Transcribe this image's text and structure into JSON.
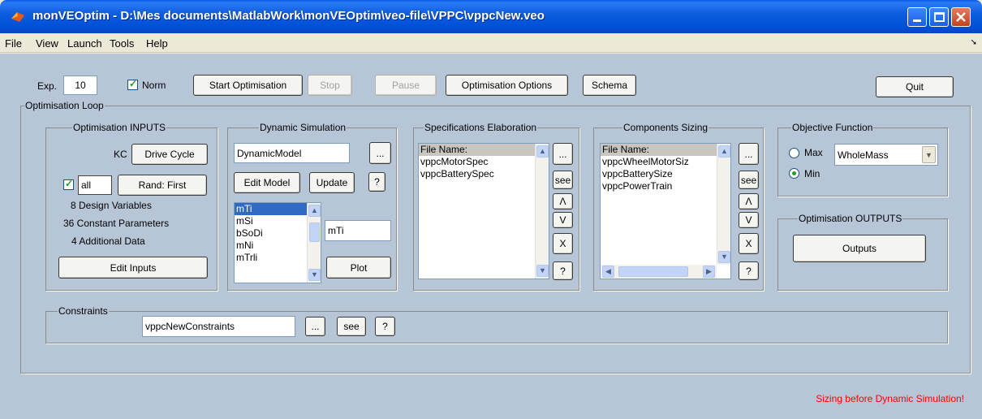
{
  "window": {
    "title": "monVEOptim - D:\\Mes documents\\MatlabWork\\monVEOptim\\veo-file\\VPPC\\vppcNew.veo"
  },
  "menu": [
    "File",
    "View",
    "Launch",
    "Tools",
    "Help"
  ],
  "menu_dock_glyph": "➘",
  "toolbar": {
    "exp_label": "Exp.",
    "exp_value": "10",
    "norm_label": "Norm",
    "start": "Start Optimisation",
    "stop": "Stop",
    "pause": "Pause",
    "options": "Optimisation Options",
    "schema": "Schema",
    "quit": "Quit"
  },
  "optim_loop": {
    "title": "Optimisation Loop"
  },
  "inputs": {
    "title": "Optimisation INPUTS",
    "kc_label": "KC",
    "drive_cycle": "Drive Cycle",
    "all_label": "all",
    "rand": "Rand: First",
    "design_vars": "8 Design Variables",
    "const_params": "36 Constant Parameters",
    "additional": "4 Additional Data",
    "edit_inputs": "Edit Inputs"
  },
  "dynsim": {
    "title": "Dynamic Simulation",
    "model": "DynamicModel",
    "browse": "...",
    "edit_model": "Edit Model",
    "update": "Update",
    "help": "?",
    "vars": [
      "mTi",
      "mSi",
      "bSoDi",
      "mNi",
      "mTrli"
    ],
    "selected_var": "mTi",
    "plot": "Plot"
  },
  "spec": {
    "title": "Specifications Elaboration",
    "items": [
      "File Name:",
      "vppcMotorSpec",
      "vppcBatterySpec"
    ],
    "browse": "...",
    "see": "see",
    "up": "Λ",
    "down": "V",
    "del": "X",
    "help": "?"
  },
  "sizing": {
    "title": "Components Sizing",
    "items": [
      "File Name:",
      "vppcWheelMotorSiz",
      "vppcBatterySize",
      "vppcPowerTrain"
    ],
    "browse": "...",
    "see": "see",
    "up": "Λ",
    "down": "V",
    "del": "X",
    "help": "?"
  },
  "objective": {
    "title": "Objective Function",
    "max": "Max",
    "min": "Min",
    "func": "WholeMass"
  },
  "outputs": {
    "title": "Optimisation OUTPUTS",
    "button": "Outputs"
  },
  "constraints": {
    "title": "Constraints",
    "file": "vppcNewConstraints",
    "browse": "...",
    "see": "see",
    "help": "?"
  },
  "status": "Sizing before Dynamic Simulation!"
}
